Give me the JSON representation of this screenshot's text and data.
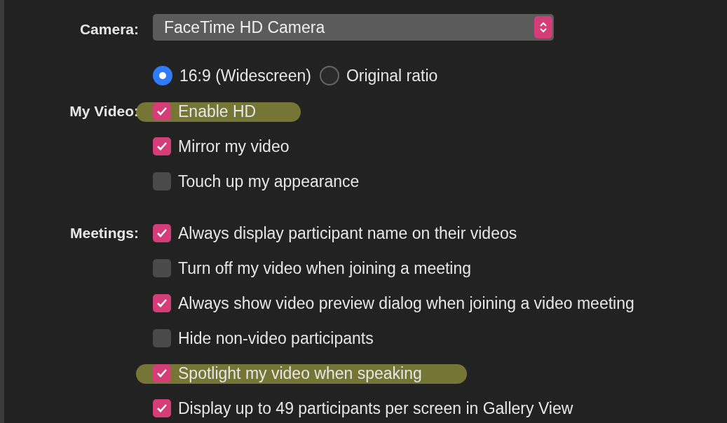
{
  "camera": {
    "label": "Camera:",
    "value": "FaceTime HD Camera"
  },
  "ratio": [
    {
      "label": "16:9 (Widescreen)",
      "selected": true
    },
    {
      "label": "Original ratio",
      "selected": false
    }
  ],
  "sections": [
    {
      "label": "My Video:",
      "options": [
        {
          "label": "Enable HD",
          "checked": true,
          "highlighted": true
        },
        {
          "label": "Mirror my video",
          "checked": true,
          "highlighted": false
        },
        {
          "label": "Touch up my appearance",
          "checked": false,
          "highlighted": false
        }
      ]
    },
    {
      "label": "Meetings:",
      "options": [
        {
          "label": "Always display participant name on their videos",
          "checked": true,
          "highlighted": false
        },
        {
          "label": "Turn off my video when joining a meeting",
          "checked": false,
          "highlighted": false
        },
        {
          "label": "Always show video preview dialog when joining a video meeting",
          "checked": true,
          "highlighted": false
        },
        {
          "label": "Hide non-video participants",
          "checked": false,
          "highlighted": false
        },
        {
          "label": "Spotlight my video when speaking",
          "checked": true,
          "highlighted": true
        },
        {
          "label": "Display up to 49 participants per screen in Gallery View",
          "checked": true,
          "highlighted": false
        }
      ]
    }
  ]
}
